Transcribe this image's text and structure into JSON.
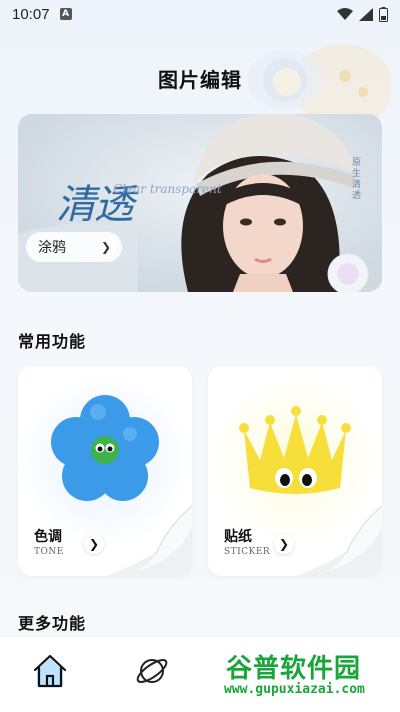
{
  "status": {
    "time": "10:07",
    "notification_letter": "A"
  },
  "header": {
    "title": "图片编辑"
  },
  "banner": {
    "title": "清透",
    "script_text": "Clear transparent",
    "vertical_text": "原生清透",
    "button_label": "涂鸦"
  },
  "sections": {
    "common": "常用功能",
    "more": "更多功能"
  },
  "cards": [
    {
      "title": "色调",
      "subtitle": "TONE",
      "icon": "flower-icon"
    },
    {
      "title": "贴纸",
      "subtitle": "STICKER",
      "icon": "crown-icon"
    }
  ],
  "bottom_nav": [
    {
      "icon": "home-icon",
      "active": true
    },
    {
      "icon": "planet-icon",
      "active": false
    }
  ],
  "watermark": {
    "name": "谷普软件园",
    "url": "www.gupuxiazai.com"
  },
  "colors": {
    "accent": "#2f6aa0",
    "flower": "#3b9be8",
    "crown": "#f6df3a",
    "watermark": "#1aa53a"
  }
}
